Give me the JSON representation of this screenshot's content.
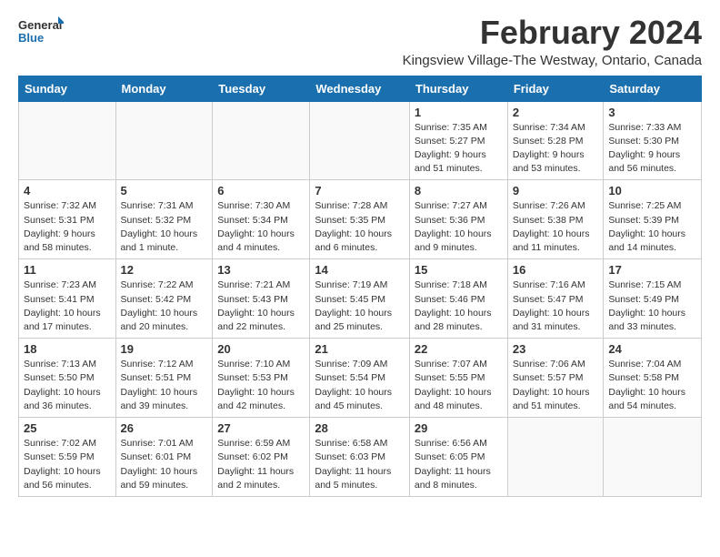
{
  "logo": {
    "general": "General",
    "blue": "Blue"
  },
  "header": {
    "month_title": "February 2024",
    "location": "Kingsview Village-The Westway, Ontario, Canada"
  },
  "weekdays": [
    "Sunday",
    "Monday",
    "Tuesday",
    "Wednesday",
    "Thursday",
    "Friday",
    "Saturday"
  ],
  "weeks": [
    [
      {
        "day": "",
        "info": ""
      },
      {
        "day": "",
        "info": ""
      },
      {
        "day": "",
        "info": ""
      },
      {
        "day": "",
        "info": ""
      },
      {
        "day": "1",
        "info": "Sunrise: 7:35 AM\nSunset: 5:27 PM\nDaylight: 9 hours\nand 51 minutes."
      },
      {
        "day": "2",
        "info": "Sunrise: 7:34 AM\nSunset: 5:28 PM\nDaylight: 9 hours\nand 53 minutes."
      },
      {
        "day": "3",
        "info": "Sunrise: 7:33 AM\nSunset: 5:30 PM\nDaylight: 9 hours\nand 56 minutes."
      }
    ],
    [
      {
        "day": "4",
        "info": "Sunrise: 7:32 AM\nSunset: 5:31 PM\nDaylight: 9 hours\nand 58 minutes."
      },
      {
        "day": "5",
        "info": "Sunrise: 7:31 AM\nSunset: 5:32 PM\nDaylight: 10 hours\nand 1 minute."
      },
      {
        "day": "6",
        "info": "Sunrise: 7:30 AM\nSunset: 5:34 PM\nDaylight: 10 hours\nand 4 minutes."
      },
      {
        "day": "7",
        "info": "Sunrise: 7:28 AM\nSunset: 5:35 PM\nDaylight: 10 hours\nand 6 minutes."
      },
      {
        "day": "8",
        "info": "Sunrise: 7:27 AM\nSunset: 5:36 PM\nDaylight: 10 hours\nand 9 minutes."
      },
      {
        "day": "9",
        "info": "Sunrise: 7:26 AM\nSunset: 5:38 PM\nDaylight: 10 hours\nand 11 minutes."
      },
      {
        "day": "10",
        "info": "Sunrise: 7:25 AM\nSunset: 5:39 PM\nDaylight: 10 hours\nand 14 minutes."
      }
    ],
    [
      {
        "day": "11",
        "info": "Sunrise: 7:23 AM\nSunset: 5:41 PM\nDaylight: 10 hours\nand 17 minutes."
      },
      {
        "day": "12",
        "info": "Sunrise: 7:22 AM\nSunset: 5:42 PM\nDaylight: 10 hours\nand 20 minutes."
      },
      {
        "day": "13",
        "info": "Sunrise: 7:21 AM\nSunset: 5:43 PM\nDaylight: 10 hours\nand 22 minutes."
      },
      {
        "day": "14",
        "info": "Sunrise: 7:19 AM\nSunset: 5:45 PM\nDaylight: 10 hours\nand 25 minutes."
      },
      {
        "day": "15",
        "info": "Sunrise: 7:18 AM\nSunset: 5:46 PM\nDaylight: 10 hours\nand 28 minutes."
      },
      {
        "day": "16",
        "info": "Sunrise: 7:16 AM\nSunset: 5:47 PM\nDaylight: 10 hours\nand 31 minutes."
      },
      {
        "day": "17",
        "info": "Sunrise: 7:15 AM\nSunset: 5:49 PM\nDaylight: 10 hours\nand 33 minutes."
      }
    ],
    [
      {
        "day": "18",
        "info": "Sunrise: 7:13 AM\nSunset: 5:50 PM\nDaylight: 10 hours\nand 36 minutes."
      },
      {
        "day": "19",
        "info": "Sunrise: 7:12 AM\nSunset: 5:51 PM\nDaylight: 10 hours\nand 39 minutes."
      },
      {
        "day": "20",
        "info": "Sunrise: 7:10 AM\nSunset: 5:53 PM\nDaylight: 10 hours\nand 42 minutes."
      },
      {
        "day": "21",
        "info": "Sunrise: 7:09 AM\nSunset: 5:54 PM\nDaylight: 10 hours\nand 45 minutes."
      },
      {
        "day": "22",
        "info": "Sunrise: 7:07 AM\nSunset: 5:55 PM\nDaylight: 10 hours\nand 48 minutes."
      },
      {
        "day": "23",
        "info": "Sunrise: 7:06 AM\nSunset: 5:57 PM\nDaylight: 10 hours\nand 51 minutes."
      },
      {
        "day": "24",
        "info": "Sunrise: 7:04 AM\nSunset: 5:58 PM\nDaylight: 10 hours\nand 54 minutes."
      }
    ],
    [
      {
        "day": "25",
        "info": "Sunrise: 7:02 AM\nSunset: 5:59 PM\nDaylight: 10 hours\nand 56 minutes."
      },
      {
        "day": "26",
        "info": "Sunrise: 7:01 AM\nSunset: 6:01 PM\nDaylight: 10 hours\nand 59 minutes."
      },
      {
        "day": "27",
        "info": "Sunrise: 6:59 AM\nSunset: 6:02 PM\nDaylight: 11 hours\nand 2 minutes."
      },
      {
        "day": "28",
        "info": "Sunrise: 6:58 AM\nSunset: 6:03 PM\nDaylight: 11 hours\nand 5 minutes."
      },
      {
        "day": "29",
        "info": "Sunrise: 6:56 AM\nSunset: 6:05 PM\nDaylight: 11 hours\nand 8 minutes."
      },
      {
        "day": "",
        "info": ""
      },
      {
        "day": "",
        "info": ""
      }
    ]
  ]
}
